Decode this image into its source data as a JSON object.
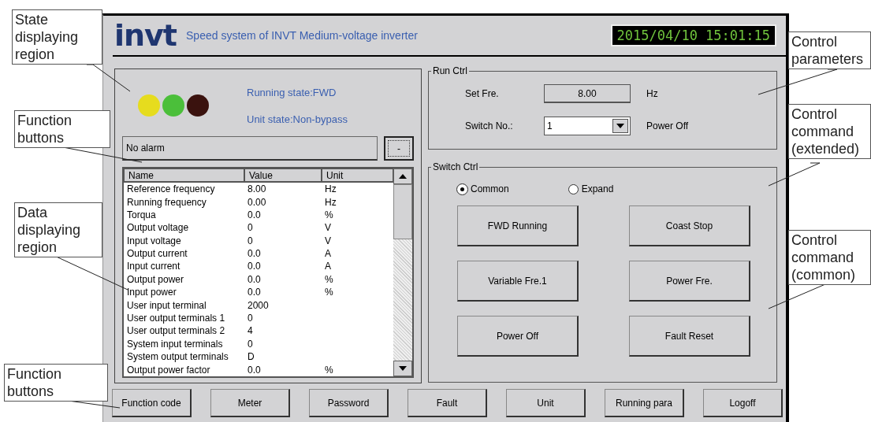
{
  "callouts": [
    {
      "text": "State displaying region"
    },
    {
      "text": "Function buttons"
    },
    {
      "text": "Data displaying region"
    },
    {
      "text": "Function buttons"
    },
    {
      "text": "Control parameters"
    },
    {
      "text": "Control command (extended)"
    },
    {
      "text": "Control command (common)"
    }
  ],
  "header": {
    "logo": "invt",
    "title": "Speed system of INVT Medium-voltage inverter",
    "clock": "2015/04/10 15:01:15"
  },
  "status": {
    "lights": [
      {
        "color": "#e6dc1e"
      },
      {
        "color": "#4bbf3a"
      },
      {
        "color": "#3a120e"
      }
    ],
    "running_state": "Running state:FWD",
    "unit_state": "Unit state:Non-bypass"
  },
  "alarm": {
    "text": "No alarm",
    "button": "-"
  },
  "table": {
    "columns": [
      "Name",
      "Value",
      "Unit"
    ],
    "rows": [
      [
        "Reference frequency",
        "8.00",
        "Hz"
      ],
      [
        "Running frequency",
        "0.00",
        "Hz"
      ],
      [
        "Torqua",
        "0.0",
        "%"
      ],
      [
        "Output voltage",
        "0",
        "V"
      ],
      [
        "Input voltage",
        "0",
        "V"
      ],
      [
        "Output current",
        "0.0",
        "A"
      ],
      [
        "Input current",
        "0.0",
        "A"
      ],
      [
        "Output power",
        "0.0",
        "%"
      ],
      [
        "Input power",
        "0.0",
        "%"
      ],
      [
        "User input terminal",
        "2000",
        ""
      ],
      [
        "User output terminals 1",
        "0",
        ""
      ],
      [
        "User output terminals 2",
        "4",
        ""
      ],
      [
        "System input terminals",
        "0",
        ""
      ],
      [
        "System output terminals",
        "D",
        ""
      ],
      [
        "Output power factor",
        "0.0",
        "%"
      ]
    ]
  },
  "run_ctrl": {
    "title": "Run Ctrl",
    "set_fre_label": "Set Fre.",
    "set_fre_value": "8.00",
    "set_fre_unit": "Hz",
    "switch_label": "Switch No.:",
    "switch_value": "1",
    "switch_status": "Power Off"
  },
  "switch_ctrl": {
    "title": "Switch Ctrl",
    "modes": [
      {
        "label": "Common",
        "selected": true
      },
      {
        "label": "Expand",
        "selected": false
      }
    ],
    "buttons": [
      "FWD Running",
      "Coast Stop",
      "Variable Fre.1",
      "Power Fre.",
      "Power Off",
      "Fault Reset"
    ]
  },
  "function_buttons": [
    "Function code",
    "Meter",
    "Password",
    "Fault",
    "Unit",
    "Running para",
    "Logoff"
  ]
}
